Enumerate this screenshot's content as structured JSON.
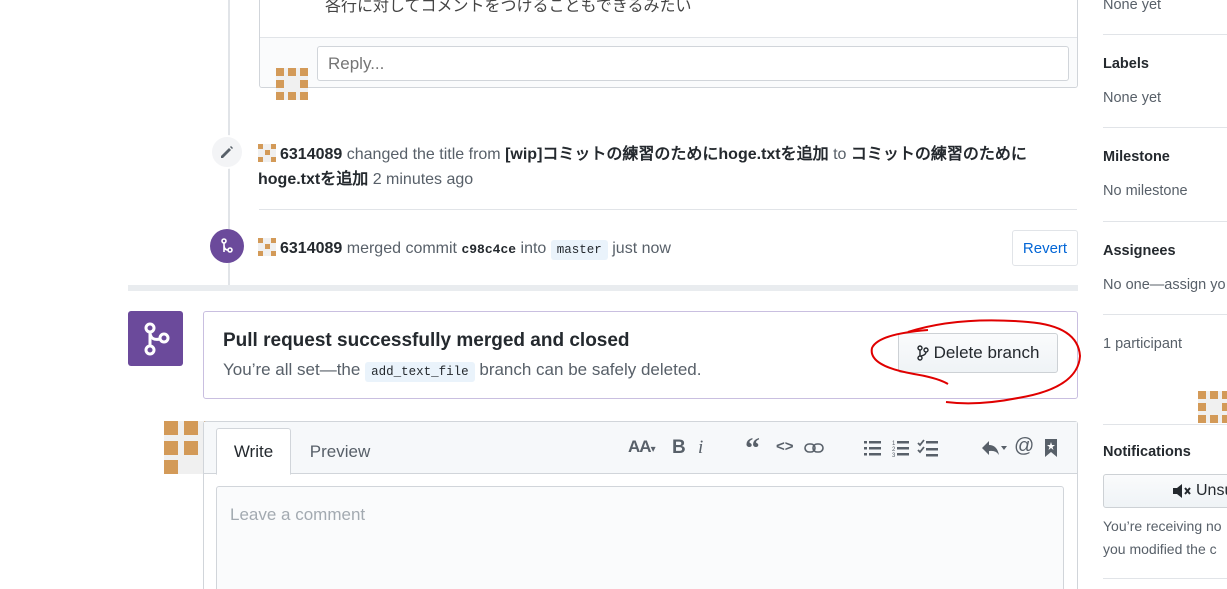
{
  "top_comment": {
    "text": "各行に対してコメントをつけることもできるみたい",
    "reply_placeholder": "Reply..."
  },
  "events": {
    "title_change": {
      "user": "6314089",
      "action": "changed the title from",
      "old_title": "[wip]コミットの練習のためにhoge.txtを追加",
      "to_word": "to",
      "new_title_line1": "コミットの練習のた",
      "new_title_line2": "めにhoge.txtを追加",
      "time": "2 minutes ago"
    },
    "merge": {
      "user": "6314089",
      "action": "merged commit",
      "commit": "c98c4ce",
      "into_word": "into",
      "branch": "master",
      "time": "just now",
      "revert_label": "Revert"
    }
  },
  "merged_box": {
    "title": "Pull request successfully merged and closed",
    "sub_prefix": "You’re all set—the",
    "branch": "add_text_file",
    "sub_suffix": "branch can be safely deleted.",
    "delete_label": "Delete branch",
    "annotation_color": "#e00000"
  },
  "comment_form": {
    "tab_write": "Write",
    "tab_preview": "Preview",
    "toolbar": {
      "header": "AA",
      "bold": "B",
      "italic": "i",
      "quote": "“",
      "code": "<>",
      "link": "link-icon",
      "ul": "unordered-list-icon",
      "ol": "ordered-list-icon",
      "tasklist": "task-list-icon",
      "reply": "reply-icon",
      "mention": "@",
      "ref": "bookmark-icon"
    },
    "placeholder": "Leave a comment"
  },
  "sidebar": {
    "top_value": "None yet",
    "labels": {
      "heading": "Labels",
      "value": "None yet"
    },
    "milestone": {
      "heading": "Milestone",
      "value": "No milestone"
    },
    "assignees": {
      "heading": "Assignees",
      "value": "No one—assign yo"
    },
    "participants": {
      "heading": "1 participant"
    },
    "notifications": {
      "heading": "Notifications",
      "button_label": "Unsu",
      "line1": "You’re receiving no",
      "line2": "you modified the c"
    }
  },
  "colors": {
    "accent_purple": "#6b4a9b",
    "link_blue": "#0366d6",
    "identicon": "#d39a58"
  }
}
